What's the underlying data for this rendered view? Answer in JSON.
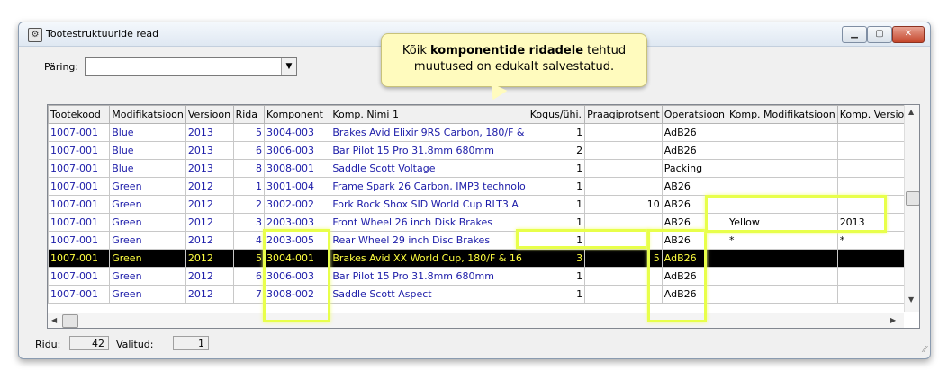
{
  "window": {
    "title": "Tootestruktuuride read",
    "app_icon": "app-icon",
    "min": "▁",
    "max": "▢",
    "close": "✕"
  },
  "query": {
    "label": "Päring:",
    "value": "",
    "arrow": "▼"
  },
  "tooltip": {
    "line1_prefix": "Kõik ",
    "line1_bold": "komponentide ridadele",
    "line1_suffix": " tehtud",
    "line2": "muutused on edukalt salvestatud."
  },
  "table": {
    "columns": [
      "Tootekood",
      "Modifikatsioon",
      "Versioon",
      "Rida",
      "Komponent",
      "Komp. Nimi 1",
      "Kogus/ühi.",
      "Praagiprotsent",
      "Operatsioon",
      "Komp. Modifikatsioon",
      "Komp. Versioon"
    ],
    "rows": [
      [
        "1007-001",
        "Blue",
        "2013",
        "5",
        "3004-003",
        "Brakes Avid Elixir 9RS Carbon, 180/F &",
        "1",
        "",
        "AdB26",
        "",
        ""
      ],
      [
        "1007-001",
        "Blue",
        "2013",
        "6",
        "3006-003",
        "Bar Pilot 15 Pro 31.8mm 680mm",
        "2",
        "",
        "AdB26",
        "",
        ""
      ],
      [
        "1007-001",
        "Blue",
        "2013",
        "8",
        "3008-001",
        "Saddle Scott Voltage",
        "1",
        "",
        "Packing",
        "",
        ""
      ],
      [
        "1007-001",
        "Green",
        "2012",
        "1",
        "3001-004",
        "Frame Spark 26 Carbon, IMP3 technolo",
        "1",
        "",
        "AB26",
        "",
        ""
      ],
      [
        "1007-001",
        "Green",
        "2012",
        "2",
        "3002-002",
        "Fork Rock Shox SID World Cup RLT3 A",
        "1",
        "10",
        "AB26",
        "",
        ""
      ],
      [
        "1007-001",
        "Green",
        "2012",
        "3",
        "2003-003",
        "Front Wheel 26 inch Disk Brakes",
        "1",
        "",
        "AB26",
        "Yellow",
        "2013"
      ],
      [
        "1007-001",
        "Green",
        "2012",
        "4",
        "2003-005",
        "Rear Wheel 29 inch Disc Brakes",
        "1",
        "",
        "AB26",
        "*",
        "*"
      ],
      [
        "1007-001",
        "Green",
        "2012",
        "5",
        "3004-001",
        "Brakes Avid XX World Cup, 180/F & 16",
        "3",
        "5",
        "AdB26",
        "",
        ""
      ],
      [
        "1007-001",
        "Green",
        "2012",
        "6",
        "3006-003",
        "Bar Pilot 15 Pro 31.8mm 680mm",
        "1",
        "",
        "AdB26",
        "",
        ""
      ],
      [
        "1007-001",
        "Green",
        "2012",
        "7",
        "3008-002",
        "Saddle Scott Aspect",
        "1",
        "",
        "AdB26",
        "",
        ""
      ]
    ],
    "selected_row": 7,
    "scroll_up": "▲",
    "scroll_down": "▼",
    "scroll_left": "◀",
    "scroll_right": "▶"
  },
  "status": {
    "rows_label": "Ridu:",
    "rows_value": "42",
    "selected_label": "Valitud:",
    "selected_value": "1",
    "grip": "⁄⁄"
  },
  "colors": {
    "highlight": "#e8ff4a",
    "link_text": "#1b1ba8",
    "selected_bg": "#000000",
    "selected_text": "#ffff40"
  }
}
